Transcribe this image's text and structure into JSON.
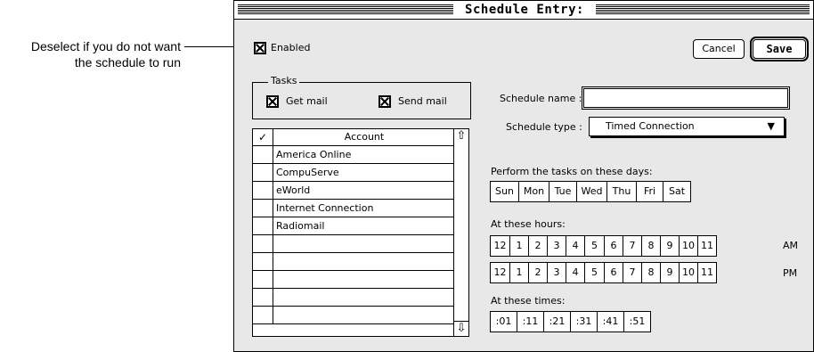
{
  "callout": {
    "line1": "Deselect if you do not want",
    "line2": "the schedule to run"
  },
  "window": {
    "title": "Schedule Entry:"
  },
  "enabled": {
    "label": "Enabled",
    "checked": true
  },
  "buttons": {
    "cancel": "Cancel",
    "save": "Save"
  },
  "tasks": {
    "title": "Tasks",
    "get_mail": {
      "label": "Get mail",
      "checked": true
    },
    "send_mail": {
      "label": "Send mail",
      "checked": true
    }
  },
  "accounts": {
    "check_header": "✓",
    "header": "Account",
    "items": [
      "America Online",
      "CompuServe",
      "eWorld",
      "Internet Connection",
      "Radiomail",
      "",
      "",
      "",
      "",
      ""
    ]
  },
  "schedule_name": {
    "label": "Schedule name :",
    "value": ""
  },
  "schedule_type": {
    "label": "Schedule type :",
    "value": "Timed Connection"
  },
  "days": {
    "label": "Perform the tasks on these days:",
    "items": [
      "Sun",
      "Mon",
      "Tue",
      "Wed",
      "Thu",
      "Fri",
      "Sat"
    ]
  },
  "hours": {
    "label": "At these hours:",
    "items": [
      "12",
      "1",
      "2",
      "3",
      "4",
      "5",
      "6",
      "7",
      "8",
      "9",
      "10",
      "11"
    ],
    "am_label": "AM",
    "pm_label": "PM"
  },
  "times": {
    "label": "At these times:",
    "items": [
      ":01",
      ":11",
      ":21",
      ":31",
      ":41",
      ":51"
    ]
  }
}
